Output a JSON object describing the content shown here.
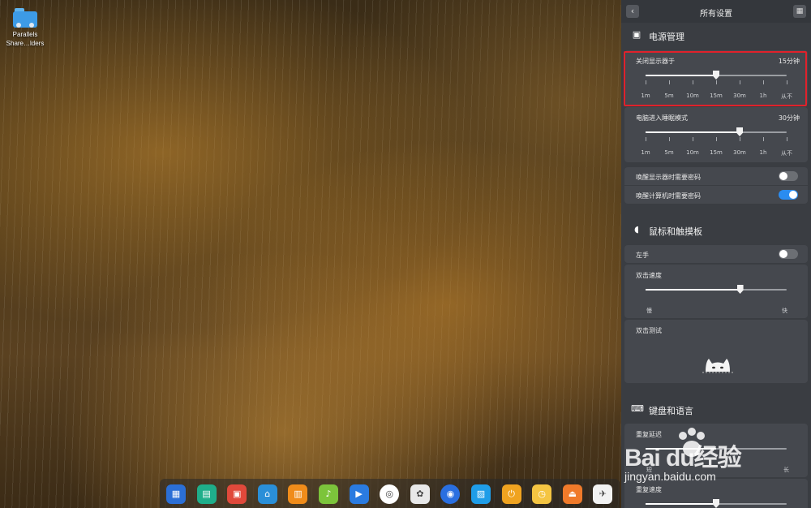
{
  "desktop": {
    "folder_label_line1": "Parallels",
    "folder_label_line2": "Share…lders"
  },
  "panel": {
    "title": "所有设置",
    "back_icon": "chevron-left-icon",
    "grid_icon": "grid-icon",
    "power": {
      "header": "电源管理",
      "monitor_off": {
        "label": "关闭显示器于",
        "value": "15分钟",
        "position_fraction": 0.5,
        "ticks": [
          "1m",
          "5m",
          "10m",
          "15m",
          "30m",
          "1h",
          "从不"
        ]
      },
      "sleep": {
        "label": "电脑进入睡眠模式",
        "value": "30分钟",
        "position_fraction": 0.667,
        "ticks": [
          "1m",
          "5m",
          "10m",
          "15m",
          "30m",
          "1h",
          "从不"
        ]
      },
      "wake_display_password": {
        "label": "唤醒显示器时需要密码",
        "on": false
      },
      "wake_computer_password": {
        "label": "唤醒计算机时需要密码",
        "on": true
      }
    },
    "mouse": {
      "header": "鼠标和触摸板",
      "left_hand": {
        "label": "左手",
        "on": false
      },
      "double_click_speed": {
        "label": "双击速度",
        "slow": "慢",
        "fast": "快",
        "position_fraction": 0.67
      },
      "double_click_test": {
        "label": "双击测试"
      }
    },
    "keyboard": {
      "header": "键盘和语言",
      "repeat_delay": {
        "label": "重复延迟",
        "short": "短",
        "long": "长"
      },
      "repeat_rate": {
        "label": "重复速度"
      }
    }
  },
  "watermark": {
    "brand": "Bai du经验",
    "url": "jingyan.baidu.com"
  },
  "colors": {
    "panel_bg": "#3a3d42",
    "card_bg": "#45484e",
    "toggle_on": "#2a8cf0",
    "toggle_off": "#6c6f74",
    "highlight": "#e0212b"
  },
  "dock": {
    "apps": [
      "launcher-icon",
      "file-manager-icon",
      "screen-recorder-icon",
      "app-store-icon",
      "archive-manager-icon",
      "music-icon",
      "video-icon",
      "chrome-icon",
      "settings-icon",
      "browser-icon",
      "monitor-icon",
      "power-icon",
      "clock-icon",
      "eject-icon",
      "qq-icon"
    ]
  }
}
